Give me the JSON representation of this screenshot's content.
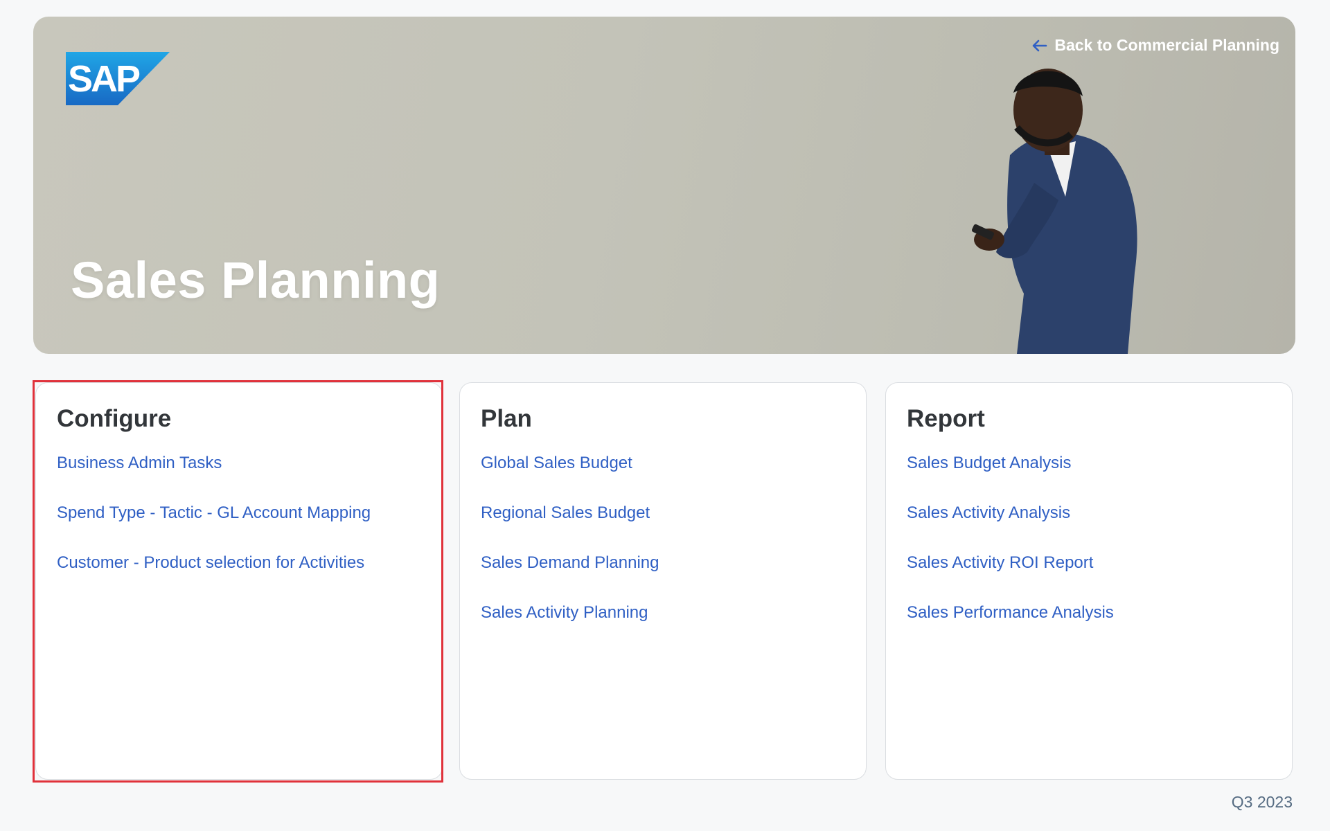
{
  "header": {
    "brand": "SAP",
    "title": "Sales Planning",
    "back_link": "Back to Commercial Planning"
  },
  "sections": [
    {
      "title": "Configure",
      "links": [
        "Business Admin Tasks",
        "Spend Type - Tactic - GL Account Mapping",
        "Customer - Product selection for Activities"
      ]
    },
    {
      "title": "Plan",
      "links": [
        "Global Sales Budget",
        "Regional Sales Budget",
        "Sales Demand Planning",
        "Sales Activity Planning"
      ]
    },
    {
      "title": "Report",
      "links": [
        "Sales Budget Analysis",
        "Sales Activity Analysis",
        "Sales Activity ROI Report",
        "Sales Performance Analysis"
      ]
    }
  ],
  "footer": {
    "period": "Q3 2023"
  },
  "colors": {
    "link": "#2f5fc4",
    "highlight": "#e0323b",
    "brand_blue": "#1a73d6"
  },
  "icons": [
    "sap-logo",
    "back-arrow-icon"
  ]
}
